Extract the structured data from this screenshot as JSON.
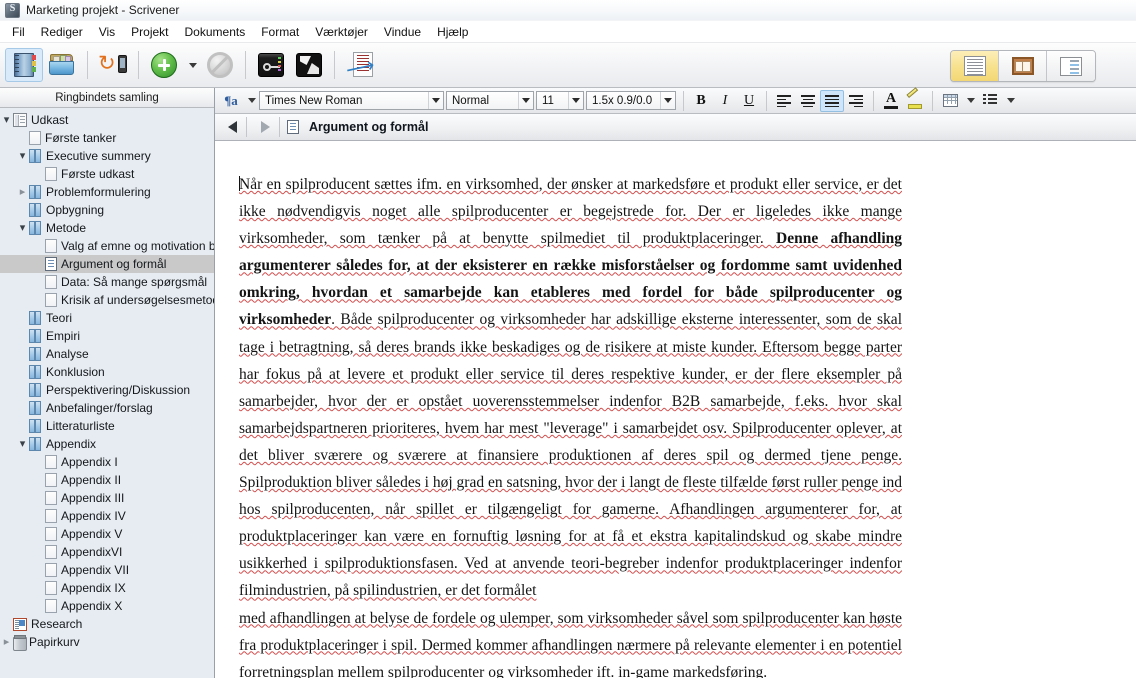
{
  "window": {
    "title": "Marketing projekt - Scrivener",
    "app_icon": "scrivener-icon"
  },
  "menubar": {
    "items": [
      {
        "label": "Fil"
      },
      {
        "label": "Rediger"
      },
      {
        "label": "Vis"
      },
      {
        "label": "Projekt"
      },
      {
        "label": "Dokuments"
      },
      {
        "label": "Format"
      },
      {
        "label": "Værktøjer"
      },
      {
        "label": "Vindue"
      },
      {
        "label": "Hjælp"
      }
    ]
  },
  "toolbar": {
    "buttons": [
      {
        "name": "binder-toggle",
        "icon": "binder-icon",
        "active": true
      },
      {
        "name": "collections-toggle",
        "icon": "collections-folder-icon",
        "active": false
      },
      {
        "name": "sync-mobile",
        "icon": "sync-icon",
        "active": false
      },
      {
        "name": "add-item",
        "icon": "green-plus-icon",
        "active": false
      },
      {
        "name": "add-item-menu",
        "icon": "chevron-down-icon",
        "active": false
      },
      {
        "name": "no-entry",
        "icon": "no-entry-icon",
        "active": false
      },
      {
        "name": "compose-mode",
        "icon": "fullscreen-key-icon",
        "active": false
      },
      {
        "name": "inspector-toggle",
        "icon": "inspector-icon",
        "active": false
      },
      {
        "name": "compile",
        "icon": "compile-export-icon",
        "active": false
      }
    ],
    "view_modes": [
      {
        "name": "view-mode-document",
        "icon": "document-view-icon",
        "selected": true
      },
      {
        "name": "view-mode-corkboard",
        "icon": "corkboard-view-icon",
        "selected": false
      },
      {
        "name": "view-mode-outliner",
        "icon": "outliner-view-icon",
        "selected": false
      }
    ]
  },
  "format_bar": {
    "paragraph_icon": "pilcrow-icon",
    "font": "Times New Roman",
    "style": "Normal",
    "size": "11",
    "spacing": "1.5x 0.9/0.0",
    "bold": "B",
    "italic": "I",
    "underline": "U",
    "align_left": "align-left-icon",
    "align_center": "align-center-icon",
    "align_justify": "align-justify-icon",
    "align_right": "align-right-icon",
    "align_active": "justify",
    "text_color": "text-color-icon",
    "highlight": "highlighter-icon",
    "table": "table-icon",
    "list": "list-icon"
  },
  "sidebar": {
    "header": "Ringbindets samling",
    "items": [
      {
        "label": "Udkast",
        "indent": 0,
        "twisty": "down",
        "icon": "draft-icon",
        "selected": false
      },
      {
        "label": "Første tanker",
        "indent": 1,
        "twisty": "none",
        "icon": "blank-page-icon",
        "selected": false
      },
      {
        "label": "Executive summery",
        "indent": 1,
        "twisty": "down",
        "icon": "folder-icon",
        "selected": false
      },
      {
        "label": "Første udkast",
        "indent": 2,
        "twisty": "none",
        "icon": "blank-page-icon",
        "selected": false
      },
      {
        "label": "Problemformulering",
        "indent": 1,
        "twisty": "right",
        "icon": "folder-icon",
        "selected": false
      },
      {
        "label": "Opbygning",
        "indent": 1,
        "twisty": "none",
        "icon": "folder-icon",
        "selected": false
      },
      {
        "label": "Metode",
        "indent": 1,
        "twisty": "down",
        "icon": "folder-icon",
        "selected": false
      },
      {
        "label": "Valg af emne og motivation bag",
        "indent": 2,
        "twisty": "none",
        "icon": "blank-page-icon",
        "selected": false
      },
      {
        "label": "Argument og formål",
        "indent": 2,
        "twisty": "none",
        "icon": "text-document-icon",
        "selected": true
      },
      {
        "label": "Data: Så mange spørgsmål",
        "indent": 2,
        "twisty": "none",
        "icon": "blank-page-icon",
        "selected": false
      },
      {
        "label": "Krisik af undersøgelsesmetode ...",
        "indent": 2,
        "twisty": "none",
        "icon": "blank-page-icon",
        "selected": false
      },
      {
        "label": "Teori",
        "indent": 1,
        "twisty": "none",
        "icon": "folder-icon",
        "selected": false
      },
      {
        "label": "Empiri",
        "indent": 1,
        "twisty": "none",
        "icon": "folder-icon",
        "selected": false
      },
      {
        "label": "Analyse",
        "indent": 1,
        "twisty": "none",
        "icon": "folder-icon",
        "selected": false
      },
      {
        "label": "Konklusion",
        "indent": 1,
        "twisty": "none",
        "icon": "folder-icon",
        "selected": false
      },
      {
        "label": "Perspektivering/Diskussion",
        "indent": 1,
        "twisty": "none",
        "icon": "folder-icon",
        "selected": false
      },
      {
        "label": "Anbefalinger/forslag",
        "indent": 1,
        "twisty": "none",
        "icon": "folder-icon",
        "selected": false
      },
      {
        "label": "Litteraturliste",
        "indent": 1,
        "twisty": "none",
        "icon": "folder-icon",
        "selected": false
      },
      {
        "label": "Appendix",
        "indent": 1,
        "twisty": "down",
        "icon": "folder-icon",
        "selected": false
      },
      {
        "label": "Appendix I",
        "indent": 2,
        "twisty": "none",
        "icon": "blank-page-icon",
        "selected": false
      },
      {
        "label": "Appendix II",
        "indent": 2,
        "twisty": "none",
        "icon": "blank-page-icon",
        "selected": false
      },
      {
        "label": "Appendix III",
        "indent": 2,
        "twisty": "none",
        "icon": "blank-page-icon",
        "selected": false
      },
      {
        "label": "Appendix IV",
        "indent": 2,
        "twisty": "none",
        "icon": "blank-page-icon",
        "selected": false
      },
      {
        "label": "Appendix V",
        "indent": 2,
        "twisty": "none",
        "icon": "blank-page-icon",
        "selected": false
      },
      {
        "label": "AppendixVI",
        "indent": 2,
        "twisty": "none",
        "icon": "blank-page-icon",
        "selected": false
      },
      {
        "label": "Appendix VII",
        "indent": 2,
        "twisty": "none",
        "icon": "blank-page-icon",
        "selected": false
      },
      {
        "label": "Appendix IX",
        "indent": 2,
        "twisty": "none",
        "icon": "blank-page-icon",
        "selected": false
      },
      {
        "label": "Appendix X",
        "indent": 2,
        "twisty": "none",
        "icon": "blank-page-icon",
        "selected": false
      },
      {
        "label": "Research",
        "indent": 0,
        "twisty": "none",
        "icon": "research-icon",
        "selected": false
      },
      {
        "label": "Papirkurv",
        "indent": 0,
        "twisty": "right",
        "icon": "trash-icon",
        "selected": false
      }
    ]
  },
  "editor": {
    "back_arrow": "back-arrow-icon",
    "forward_arrow": "forward-arrow-icon",
    "doc_icon": "text-document-icon",
    "title": "Argument og formål",
    "paragraphs": [
      {
        "id": "p1",
        "runs": [
          {
            "text": "Når en spilproducent sættes ifm. en virksomhed, der ønsker at markedsføre et produkt eller service, er det ikke nødvendigvis noget alle spilproducenter  er begejstrede  for. Der er ligeledes  ikke mange  virksomheder,  som tænker på at benytte spilmediet til produktplaceringer.  ",
            "bold": false
          },
          {
            "text": "Denne afhandling argumenterer  således for, at der eksisterer en række misforståelser  og fordomme samt uvidenhed omkring, hvordan et samarbejde kan etableres med fordel for både spilproducenter og virksomheder",
            "bold": true
          },
          {
            "text": ". Både spilproducenter og virksomheder har adskillige eksterne interessenter, som de skal tage i betragtning, så deres brands ikke beskadiges og de risikere at miste kunder. Eftersom begge parter har fokus på at levere et produkt eller service til deres respektive kunder, er der flere eksempler på samarbejder, hvor der er opstået uoverensstemmelser  indenfor B2B samarbejde,  f.eks. hvor skal samarbejdspartneren prioriteres, hvem har mest \"leverage\" i samarbejdet osv. Spilproducenter oplever, at det bliver sværere og sværere at finansiere produktionen af deres spil og dermed tjene penge. Spilproduktion bliver således i høj grad en satsning, hvor der i langt de fleste tilfælde først ruller penge ind hos spilproducenten, når  spillet  er tilgængeligt  for  gamerne.  Afhandlingen  argumenterer  for,  at  produktplaceringer  kan  være  en fornuftig løsning for at få et ekstra kapitalindskud og skabe mindre usikkerhed i spilproduktionsfasen.  Ved at anvende teori-begreber indenfor produktplaceringer  indenfor filmindustrien,  på spilindustrien,  er det formålet",
            "bold": false
          }
        ]
      },
      {
        "id": "p2",
        "runs": [
          {
            "text": "med afhandlingen at belyse de fordele og ulemper, som virksomheder såvel som spilproducenter kan høste fra produktplaceringer  i  spil.  Dermed  kommer  afhandlingen  nærmere  på  relevante  elementer  i  en  potentiel forretningsplan mellem spilproducenter og virksomheder ift. in-game markedsføring.",
            "bold": false
          }
        ]
      }
    ]
  },
  "colors": {
    "selection_gray": "#c9c9c9",
    "sidebar_bg": "#e7ecf2",
    "toolbar_active_blue": "#d9ebfb",
    "view_mode_selected_yellow": "#f7e18c",
    "spellcheck_red": "#d34d4d"
  }
}
